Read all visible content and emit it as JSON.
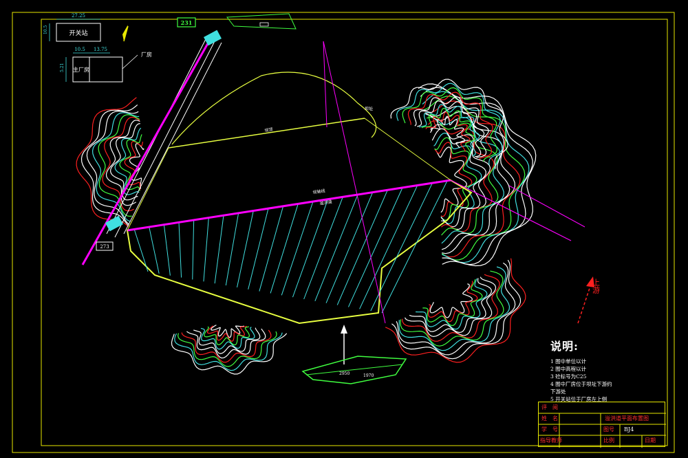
{
  "drawing": {
    "top_box_label": "开关站",
    "room_label": "主厂房",
    "plant_label": "厂房",
    "dim_top_left": "27.25",
    "dim_left_small": "10.5",
    "dim_top_small": "10.5",
    "dim_mid": "13.75",
    "dim_side": "5.21",
    "station_badge": "231",
    "dam_axis_label": "坝轴线",
    "upstream_label": "上游",
    "crest_label": "坝顶",
    "toe_label": "坝址",
    "spillway_label": "溢洪道",
    "el_left": "273",
    "tail_label": "2950",
    "tail_label_2": "1970"
  },
  "notes": {
    "title": "说明:",
    "items": [
      "1 图中单位以计",
      "2 图中高程以计",
      "3 砼标号为C25",
      "4 图中厂房位于坝址下游约",
      "  下游处",
      "5 开关站位于厂房左上侧"
    ]
  },
  "title_block": {
    "name_label": "姓　名",
    "id_label": "学　号",
    "advisor_label": "指导教师",
    "reviewer_label": "评　阅",
    "drawing_title": "溢洪道平面布置图",
    "number_label": "图号",
    "number_value": "BJ4",
    "ratio_label": "比例",
    "date_label": "日期"
  },
  "colors": {
    "frame": "#e8e800",
    "dam_axis": "#ff00ff",
    "spillway": "#40e0e0",
    "contour_white": "#ffffff",
    "contour_red": "#ff2020",
    "contour_green": "#40ff40",
    "contour_cyan": "#40e0e0",
    "reservoir_outline": "#e8ff40"
  }
}
